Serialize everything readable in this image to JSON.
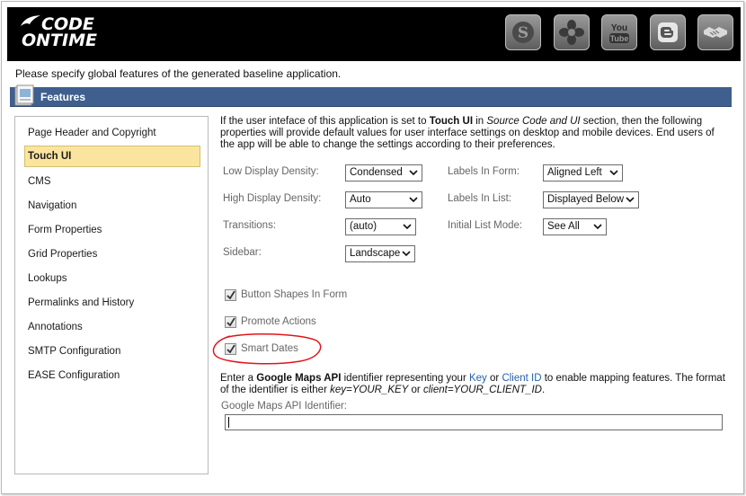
{
  "header": {
    "logo_line1": "CODE",
    "logo_line2": "ONTIME",
    "social_icons": [
      "stumbleupon-icon",
      "flower-icon",
      "youtube-icon",
      "blogger-icon",
      "handshake-icon"
    ],
    "youtube_top": "You",
    "youtube_bottom": "Tube"
  },
  "intro": "Please specify global features of the generated baseline application.",
  "features_bar": {
    "title": "Features"
  },
  "sidebar": {
    "items": [
      {
        "label": "Page Header and Copyright"
      },
      {
        "label": "Touch UI"
      },
      {
        "label": "CMS"
      },
      {
        "label": "Navigation"
      },
      {
        "label": "Form Properties"
      },
      {
        "label": "Grid Properties"
      },
      {
        "label": "Lookups"
      },
      {
        "label": "Permalinks and History"
      },
      {
        "label": "Annotations"
      },
      {
        "label": "SMTP Configuration"
      },
      {
        "label": "EASE Configuration"
      }
    ],
    "active_index": 1
  },
  "description": {
    "part1": "If the user inteface of this application is set to ",
    "bold": "Touch UI",
    "part2": " in ",
    "italic": "Source Code and UI",
    "part3": " section, then the following properties will provide default values for user interface settings on desktop and mobile devices. End users of the app will be able to change the settings according to their preferences."
  },
  "settings": {
    "low_density": {
      "label": "Low Display Density:",
      "value": "Condensed"
    },
    "high_density": {
      "label": "High Display Density:",
      "value": "Auto"
    },
    "transitions": {
      "label": "Transitions:",
      "value": "(auto)"
    },
    "sidebar": {
      "label": "Sidebar:",
      "value": "Landscape"
    },
    "labels_in_form": {
      "label": "Labels In Form:",
      "value": "Aligned Left"
    },
    "labels_in_list": {
      "label": "Labels In List:",
      "value": "Displayed Below"
    },
    "initial_list_mode": {
      "label": "Initial List Mode:",
      "value": "See All"
    }
  },
  "checkboxes": [
    {
      "label": "Button Shapes In Form",
      "checked": true
    },
    {
      "label": "Promote Actions",
      "checked": true
    },
    {
      "label": "Smart Dates",
      "checked": true
    }
  ],
  "google_maps": {
    "t1": "Enter a ",
    "bold": "Google Maps API",
    "t2": " identifier representing your ",
    "link_key": "Key",
    "t3": " or ",
    "link_client": "Client ID",
    "t4": " to enable mapping features. The format of the identifier is either ",
    "i1": "key=YOUR_KEY",
    "t5": " or ",
    "i2": "client=YOUR_CLIENT_ID",
    "t6": ".",
    "field_label": "Google Maps API Identifier:",
    "field_value": ""
  },
  "colors": {
    "features_bar": "#3f5f8e",
    "active_item": "#fbe59e",
    "annotation": "#e0151b",
    "link": "#2461a8"
  }
}
